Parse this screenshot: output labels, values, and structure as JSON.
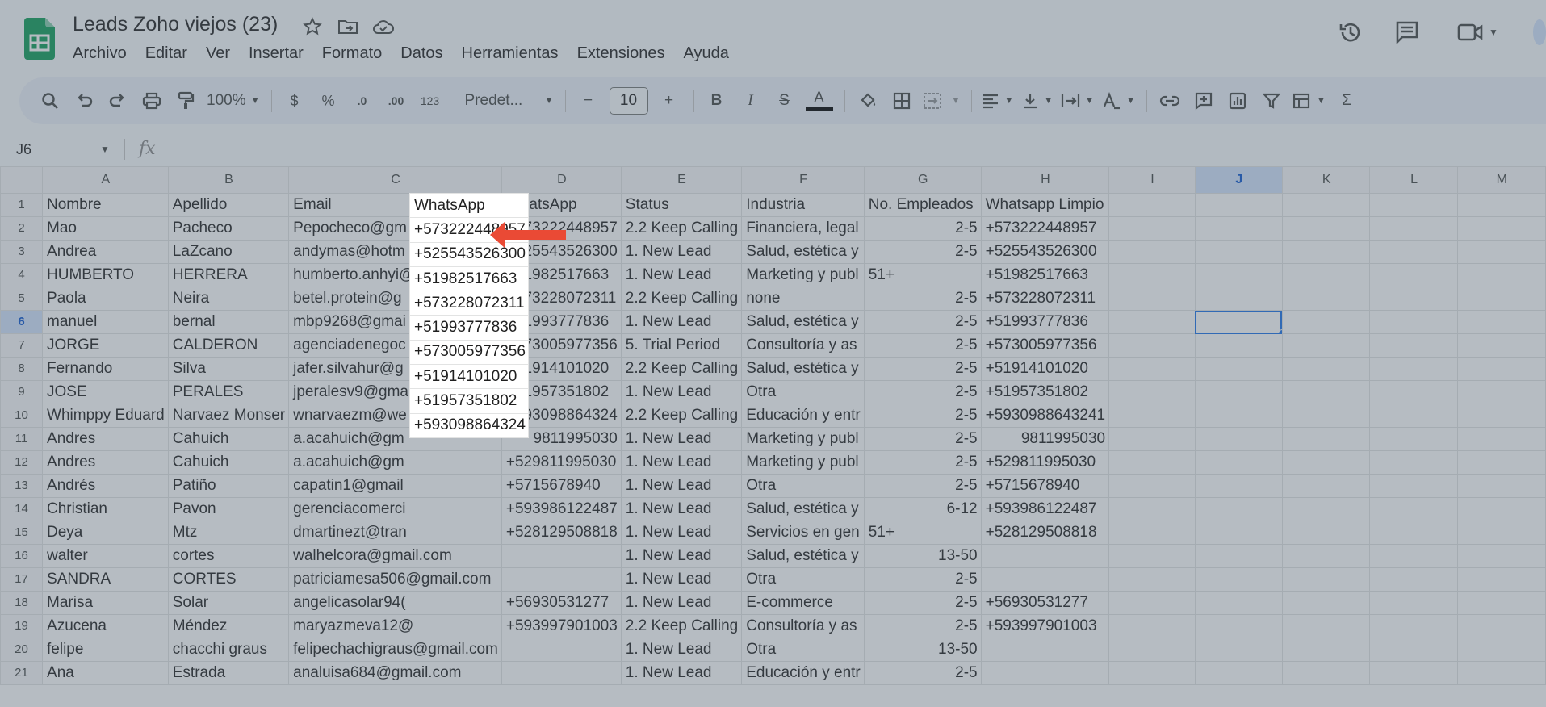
{
  "app": {
    "title": "Leads Zoho viejos (23)",
    "menu": [
      "Archivo",
      "Editar",
      "Ver",
      "Insertar",
      "Formato",
      "Datos",
      "Herramientas",
      "Extensiones",
      "Ayuda"
    ]
  },
  "toolbar": {
    "zoom": "100%",
    "currency": "$",
    "percent": "%",
    "dec_decrease": ".0",
    "dec_increase": ".00",
    "format_123": "123",
    "font": "Predet...",
    "minus": "−",
    "font_size": "10",
    "plus": "+",
    "bold": "B",
    "italic": "I",
    "strike": "S",
    "text_color": "A",
    "sigma": "Σ"
  },
  "formula_bar": {
    "cell_ref": "J6",
    "fx": "fx"
  },
  "columns": [
    "A",
    "B",
    "C",
    "D",
    "E",
    "F",
    "G",
    "H",
    "I",
    "J",
    "K",
    "L",
    "M"
  ],
  "selected_column": "J",
  "selected_row": 6,
  "rows": [
    {
      "n": "1",
      "a": "Nombre",
      "b": "Apellido",
      "c": "Email",
      "d": "WhatsApp",
      "e": "Status",
      "f": "Industria",
      "g": "No. Empleados",
      "h": "Whatsapp Limpio"
    },
    {
      "n": "2",
      "a": "Mao",
      "b": "Pacheco",
      "c": "Pepocheco@gm",
      "d": "+573222448957",
      "e": "2.2 Keep Calling",
      "f": "Financiera, legal",
      "g": "2-5",
      "h": "+573222448957"
    },
    {
      "n": "3",
      "a": "Andrea",
      "b": "LaZcano",
      "c": "andymas@hotm",
      "d": "+525543526300",
      "e": "1. New Lead",
      "f": "Salud, estética y",
      "g": "2-5",
      "h": "+525543526300"
    },
    {
      "n": "4",
      "a": "HUMBERTO",
      "b": "HERRERA",
      "c": "humberto.anhyi@",
      "d": "+51982517663",
      "e": "1. New Lead",
      "f": "Marketing y publ",
      "g": "51+",
      "h": "+51982517663"
    },
    {
      "n": "5",
      "a": "Paola",
      "b": "Neira",
      "c": "betel.protein@g",
      "d": "+573228072311",
      "e": "2.2 Keep Calling",
      "f": "none",
      "g": "2-5",
      "h": "+573228072311"
    },
    {
      "n": "6",
      "a": "manuel",
      "b": "bernal",
      "c": "mbp9268@gmai",
      "d": "+51993777836",
      "e": "1. New Lead",
      "f": "Salud, estética y",
      "g": "2-5",
      "h": "+51993777836"
    },
    {
      "n": "7",
      "a": "JORGE",
      "b": "CALDERON",
      "c": "agenciadenegoc",
      "d": "+573005977356",
      "e": "5. Trial Period",
      "f": "Consultoría y as",
      "g": "2-5",
      "h": "+573005977356"
    },
    {
      "n": "8",
      "a": "Fernando",
      "b": "Silva",
      "c": "jafer.silvahur@g",
      "d": "+51914101020",
      "e": "2.2 Keep Calling",
      "f": "Salud, estética y",
      "g": "2-5",
      "h": "+51914101020"
    },
    {
      "n": "9",
      "a": "JOSE",
      "b": "PERALES",
      "c": "jperalesv9@gma",
      "d": "+51957351802",
      "e": "1. New Lead",
      "f": "Otra",
      "g": "2-5",
      "h": "+51957351802"
    },
    {
      "n": "10",
      "a": "Whimppy Eduard",
      "b": "Narvaez Monser",
      "c": "wnarvaezm@we",
      "d": "+593098864324",
      "e": "2.2 Keep Calling",
      "f": "Educación y entr",
      "g": "2-5",
      "h": "+5930988643241"
    },
    {
      "n": "11",
      "a": "Andres",
      "b": "Cahuich",
      "c": "a.acahuich@gm",
      "d": "9811995030",
      "e": "1. New Lead",
      "f": "Marketing y publ",
      "g": "2-5",
      "h": "9811995030"
    },
    {
      "n": "12",
      "a": "Andres",
      "b": "Cahuich",
      "c": "a.acahuich@gm",
      "d": "+529811995030",
      "e": "1. New Lead",
      "f": "Marketing y publ",
      "g": "2-5",
      "h": "+529811995030"
    },
    {
      "n": "13",
      "a": "Andrés",
      "b": "Patiño",
      "c": "capatin1@gmail",
      "d": "+5715678940",
      "e": "1. New Lead",
      "f": "Otra",
      "g": "2-5",
      "h": "+5715678940"
    },
    {
      "n": "14",
      "a": "Christian",
      "b": "Pavon",
      "c": "gerenciacomerci",
      "d": "+593986122487",
      "e": "1. New Lead",
      "f": "Salud, estética y",
      "g": "6-12",
      "h": "+593986122487"
    },
    {
      "n": "15",
      "a": "Deya",
      "b": "Mtz",
      "c": "dmartinezt@tran",
      "d": "+528129508818",
      "e": "1. New Lead",
      "f": "Servicios en gen",
      "g": "51+",
      "h": "+528129508818"
    },
    {
      "n": "16",
      "a": "walter",
      "b": "cortes",
      "c": "walhelcora@gmail.com",
      "d": "",
      "e": "1. New Lead",
      "f": "Salud, estética y",
      "g": "13-50",
      "h": ""
    },
    {
      "n": "17",
      "a": "SANDRA",
      "b": "CORTES",
      "c": "patriciamesa506@gmail.com",
      "d": "",
      "e": "1. New Lead",
      "f": "Otra",
      "g": "2-5",
      "h": ""
    },
    {
      "n": "18",
      "a": "Marisa",
      "b": "Solar",
      "c": "angelicasolar94(",
      "d": "+56930531277",
      "e": "1. New Lead",
      "f": "E-commerce",
      "g": "2-5",
      "h": "+56930531277"
    },
    {
      "n": "19",
      "a": "Azucena",
      "b": "Méndez",
      "c": "maryazmeva12@",
      "d": "+593997901003",
      "e": "2.2 Keep Calling",
      "f": "Consultoría y as",
      "g": "2-5",
      "h": "+593997901003"
    },
    {
      "n": "20",
      "a": "felipe",
      "b": "chacchi graus",
      "c": "felipechachigraus@gmail.com",
      "d": "",
      "e": "1. New Lead",
      "f": "Otra",
      "g": "13-50",
      "h": ""
    },
    {
      "n": "21",
      "a": "Ana",
      "b": "Estrada",
      "c": "analuisa684@gmail.com",
      "d": "",
      "e": "1. New Lead",
      "f": "Educación y entr",
      "g": "2-5",
      "h": ""
    }
  ]
}
